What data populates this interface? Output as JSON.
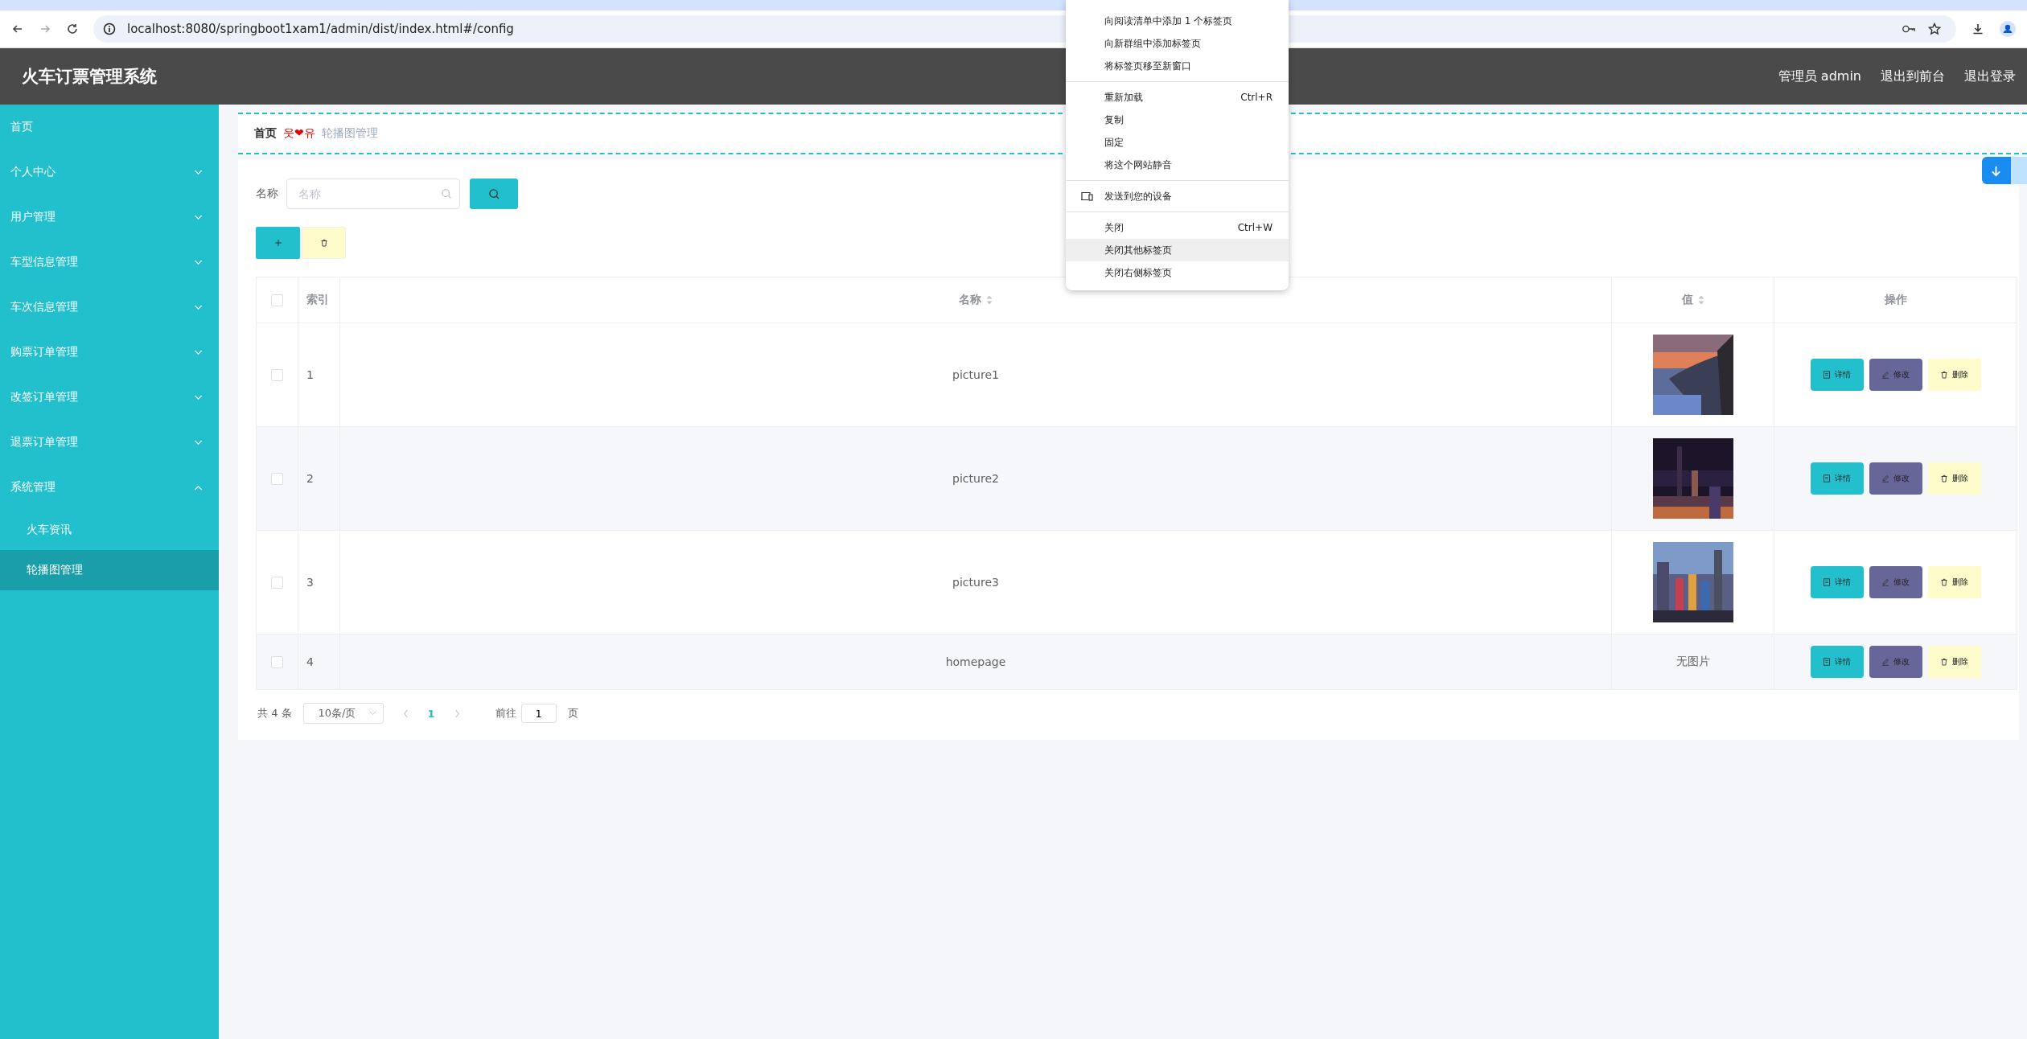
{
  "browser": {
    "url": "localhost:8080/springboot1xam1/admin/dist/index.html#/config"
  },
  "header": {
    "title": "火车订票管理系统",
    "user": "管理员 admin",
    "links": [
      "退出到前台",
      "退出登录"
    ]
  },
  "sidebar": {
    "items": [
      {
        "kind": "link",
        "label": "首页",
        "selected": false
      },
      {
        "kind": "submenu",
        "label": "个人中心",
        "expanded": false,
        "selected": false
      },
      {
        "kind": "submenu",
        "label": "用户管理",
        "expanded": false,
        "selected": false
      },
      {
        "kind": "submenu",
        "label": "车型信息管理",
        "expanded": false,
        "selected": false
      },
      {
        "kind": "submenu",
        "label": "车次信息管理",
        "expanded": false,
        "selected": false
      },
      {
        "kind": "submenu",
        "label": "购票订单管理",
        "expanded": false,
        "selected": false
      },
      {
        "kind": "submenu",
        "label": "改签订单管理",
        "expanded": false,
        "selected": false
      },
      {
        "kind": "submenu",
        "label": "退票订单管理",
        "expanded": false,
        "selected": false
      },
      {
        "kind": "submenu",
        "label": "系统管理",
        "expanded": true,
        "selected": false,
        "children": [
          {
            "label": "火车资讯",
            "selected": false
          },
          {
            "label": "轮播图管理",
            "selected": true
          }
        ]
      }
    ]
  },
  "breadcrumb": {
    "separator": "웃❤유",
    "items": [
      {
        "label": "首页",
        "current": false
      },
      {
        "label": "轮播图管理",
        "current": true
      }
    ]
  },
  "search": {
    "label": "名称",
    "placeholder": "名称"
  },
  "table": {
    "header_checked": false,
    "columns": [
      {
        "label": "索引",
        "sortable": false
      },
      {
        "label": "名称",
        "sortable": true
      },
      {
        "label": "值",
        "sortable": true
      },
      {
        "label": "操作",
        "sortable": false
      }
    ],
    "rows": [
      {
        "checked": false,
        "index": "1",
        "name": "picture1",
        "value": {
          "kind": "picture"
        },
        "actions": [
          "详情",
          "修改",
          "删除"
        ]
      },
      {
        "checked": false,
        "index": "2",
        "name": "picture2",
        "value": {
          "kind": "picture"
        },
        "actions": [
          "详情",
          "修改",
          "删除"
        ]
      },
      {
        "checked": false,
        "index": "3",
        "name": "picture3",
        "value": {
          "kind": "picture"
        },
        "actions": [
          "详情",
          "修改",
          "删除"
        ]
      },
      {
        "checked": false,
        "index": "4",
        "name": "homepage",
        "value": {
          "kind": "text",
          "text": "无图片"
        },
        "actions": [
          "详情",
          "修改",
          "删除"
        ]
      }
    ]
  },
  "pagination": {
    "total": "共 4 条",
    "page_size": "10条/页",
    "pages": [
      {
        "label": "1",
        "selected": true
      }
    ],
    "goto_label": "前往",
    "goto_value": "1",
    "goto_suffix": "页"
  },
  "context_menu": {
    "groups": [
      [
        {
          "label": "向阅读清单中添加 1 个标签页",
          "hovered": false
        },
        {
          "label": "向新群组中添加标签页",
          "hovered": false
        },
        {
          "label": "将标签页移至新窗口",
          "hovered": false
        }
      ],
      [
        {
          "label": "重新加载",
          "shortcut": "Ctrl+R",
          "hovered": false
        },
        {
          "label": "复制",
          "hovered": false
        },
        {
          "label": "固定",
          "hovered": false
        },
        {
          "label": "将这个网站静音",
          "hovered": false
        }
      ],
      [
        {
          "label": "发送到您的设备",
          "kind": "with_icon",
          "hovered": false
        }
      ],
      [
        {
          "label": "关闭",
          "shortcut": "Ctrl+W",
          "hovered": false
        },
        {
          "label": "关闭其他标签页",
          "hovered": true
        },
        {
          "label": "关闭右侧标签页",
          "hovered": false
        }
      ]
    ]
  }
}
